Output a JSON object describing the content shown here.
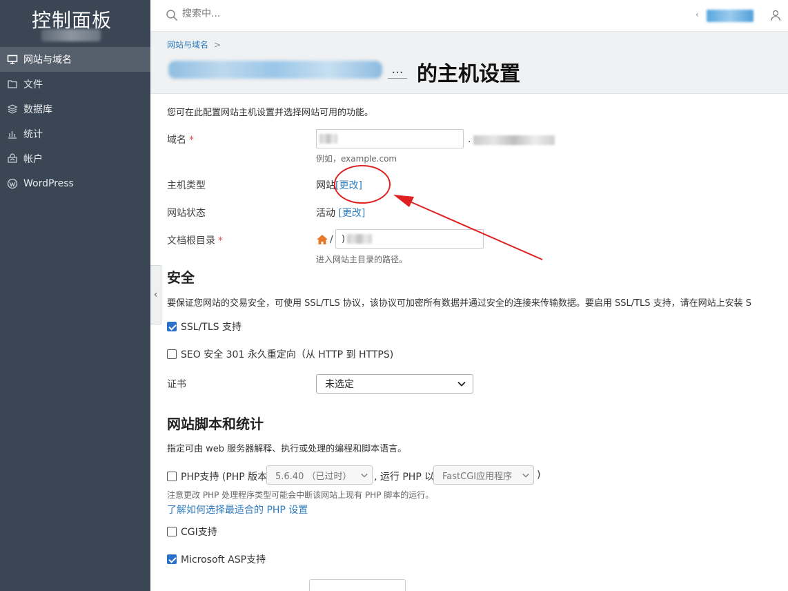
{
  "sidebar": {
    "brand": "控制面板",
    "items": [
      {
        "label": "网站与域名",
        "icon": "monitor-icon"
      },
      {
        "label": "文件",
        "icon": "folder-icon"
      },
      {
        "label": "数据库",
        "icon": "database-icon"
      },
      {
        "label": "统计",
        "icon": "bar-chart-icon"
      },
      {
        "label": "帐户",
        "icon": "account-icon"
      },
      {
        "label": "WordPress",
        "icon": "wordpress-icon"
      }
    ]
  },
  "topbar": {
    "search_placeholder": "搜索中..."
  },
  "header": {
    "breadcrumb": "网站与域名",
    "breadcrumb_sep": ">",
    "ellipsis": "...",
    "title": "的主机设置"
  },
  "form": {
    "intro": "您可在此配置网站主机设置并选择网站可用的功能。",
    "domain_label": "域名",
    "required_mark": "*",
    "domain_hint": "例如，example.com",
    "domain_dot": ".",
    "host_type_label": "主机类型",
    "host_type_value": "网站",
    "change_link": "[更改]",
    "site_status_label": "网站状态",
    "site_status_value": "活动",
    "docroot_label": "文档根目录",
    "docroot_slash": "/",
    "docroot_value": ")",
    "docroot_hint": "进入网站主目录的路径。"
  },
  "security": {
    "title": "安全",
    "desc": "要保证您网站的交易安全，可使用 SSL/TLS 协议，该协议可加密所有数据并通过安全的连接来传输数据。要启用 SSL/TLS 支持，请在网站上安装 S",
    "ssl_label": "SSL/TLS 支持",
    "ssl_checked": true,
    "seo_label": "SEO 安全 301 永久重定向（从 HTTP 到 HTTPS)",
    "seo_checked": false,
    "cert_label": "证书",
    "cert_value": "未选定"
  },
  "scripts": {
    "title": "网站脚本和统计",
    "desc": "指定可由 web 服务器解释、执行或处理的编程和脚本语言。",
    "php_label": "PHP支持 (PHP 版本",
    "php_version": "5.6.40 （已过时）",
    "php_run_label": ", 运行 PHP 以",
    "php_handler": "FastCGI应用程序",
    "php_close": ")",
    "php_note": "注意更改 PHP 处理程序类型可能会中断该网站上现有 PHP 脚本的运行。",
    "php_link": "了解如何选择最适合的 PHP 设置",
    "cgi_label": "CGI支持",
    "cgi_checked": false,
    "asp_label": "Microsoft ASP支持",
    "asp_checked": true
  },
  "colors": {
    "sidebar_bg": "#3a4654",
    "sidebar_active": "#56606d",
    "link": "#2e7bbd",
    "annotation_red": "#e02020",
    "checkbox_blue": "#2b70c9"
  }
}
